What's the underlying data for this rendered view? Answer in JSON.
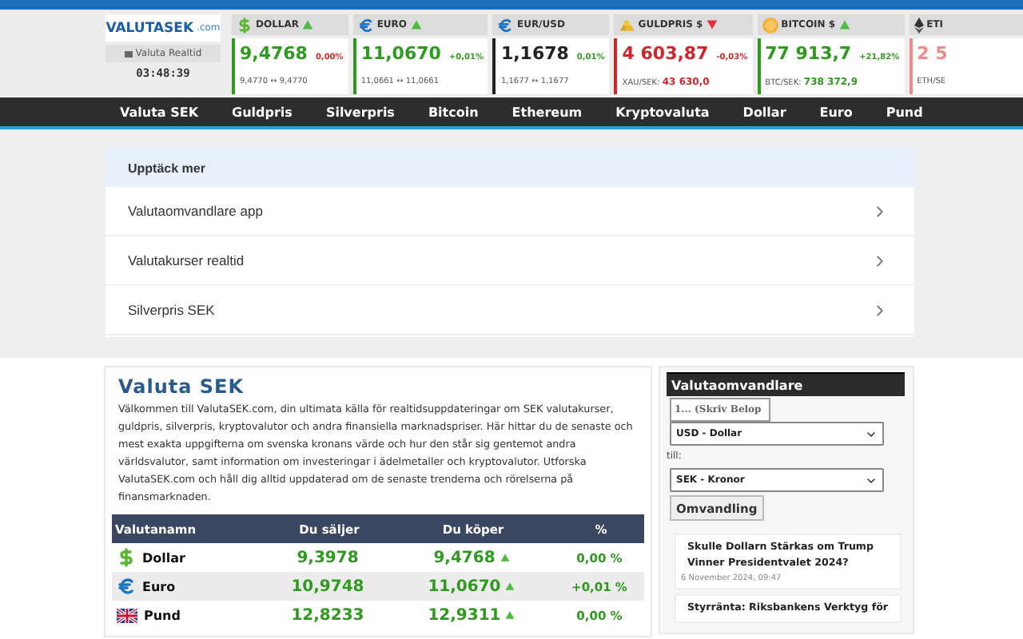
{
  "header": {
    "logo_main": "VALUTASEK",
    "logo_suffix": ".com",
    "realtime_label": "Valuta Realtid",
    "clock": "03:48:39"
  },
  "tickers": [
    {
      "kind": "dollar",
      "name": "DOLLAR",
      "rising": true,
      "price": "9,4768",
      "color": "#2e9a1e",
      "change": {
        "text": "0,00%",
        "color": "#d0262b"
      },
      "detail": {
        "text": "9,4770 ↔ 9,4770"
      }
    },
    {
      "kind": "euro",
      "name": "EURO",
      "rising": true,
      "price": "11,0670",
      "color": "#2e9a1e",
      "change": {
        "text": "+0,01%",
        "color": "#2e9a1e"
      },
      "detail": {
        "text": "11,0661 ↔ 11,0661"
      }
    },
    {
      "kind": "euro",
      "name": "EUR/USD",
      "price": "1,1678",
      "color": "#222222",
      "change": {
        "text": "0,01%",
        "color": "#2e9a1e"
      },
      "detail": {
        "text": "1,1677 ↔ 1,1677"
      }
    },
    {
      "kind": "gold",
      "name": "GULDPRIS $",
      "rising": false,
      "price": "4 603,87",
      "color": "#d0262b",
      "change": {
        "text": "-0,03%",
        "color": "#d0262b"
      },
      "detail": {
        "text": "XAU/SEK:",
        "value": "43 630,0",
        "color": "#d0262b"
      }
    },
    {
      "kind": "bitcoin",
      "name": "BITCOIN $",
      "rising": true,
      "price": "77 913,7",
      "color": "#2e9a1e",
      "change": {
        "text": "+21,82%",
        "color": "#2e9a1e"
      },
      "detail": {
        "text": "BTC/SEK:",
        "value": "738 372,9",
        "color": "#2e9a1e"
      }
    },
    {
      "kind": "ethereum",
      "name": "ETI",
      "price": "2 5",
      "color": "#f08a8a",
      "detail": {
        "text": "ETH/SE"
      }
    }
  ],
  "nav": [
    "Valuta SEK",
    "Guldpris",
    "Silverpris",
    "Bitcoin",
    "Ethereum",
    "Kryptovaluta",
    "Dollar",
    "Euro",
    "Pund"
  ],
  "discover": {
    "title": "Upptäck mer",
    "items": [
      "Valutaomvandlare app",
      "Valutakurser realtid",
      "Silverpris SEK"
    ]
  },
  "article": {
    "title": "Valuta SEK",
    "text": "Välkommen till ValutaSEK.com, din ultimata källa för realtidsuppdateringar om SEK valutakurser, guldpris, silverpris, kryptovalutor och andra finansiella marknadspriser. Här hittar du de senaste och mest exakta uppgifterna om svenska kronans värde och hur den står sig gentemot andra världsvalutor, samt information om investeringar i ädelmetaller och kryptovalutor. Utforska ValutaSEK.com och håll dig alltid uppdaterad om de senaste trenderna och rörelserna på finansmarknaden."
  },
  "table": {
    "columns": [
      "Valutanamn",
      "Du säljer",
      "Du köper",
      "%"
    ],
    "rows": [
      {
        "kind": "dollar",
        "name": "Dollar",
        "sell": "9,3978",
        "buy": "9,4768",
        "rising": true,
        "pct": "0,00 %"
      },
      {
        "kind": "euro",
        "name": "Euro",
        "sell": "10,9748",
        "buy": "11,0670",
        "rising": true,
        "pct": "+0,01 %"
      },
      {
        "kind": "uk",
        "name": "Pund",
        "sell": "12,8233",
        "buy": "12,9311",
        "rising": true,
        "pct": "0,00 %"
      }
    ]
  },
  "converter": {
    "title": "Valutaomvandlare",
    "amount_placeholder": "1... (Skriv Belop",
    "from": "USD - Dollar",
    "to_label": "till:",
    "to": "SEK - Kronor",
    "button": "Omvandling"
  },
  "news": [
    {
      "title": "Skulle Dollarn Stärkas om Trump Vinner Presidentvalet 2024?",
      "date": "6 November 2024, 09:47"
    },
    {
      "title": "Styrränta: Riksbankens Verktyg för"
    }
  ]
}
